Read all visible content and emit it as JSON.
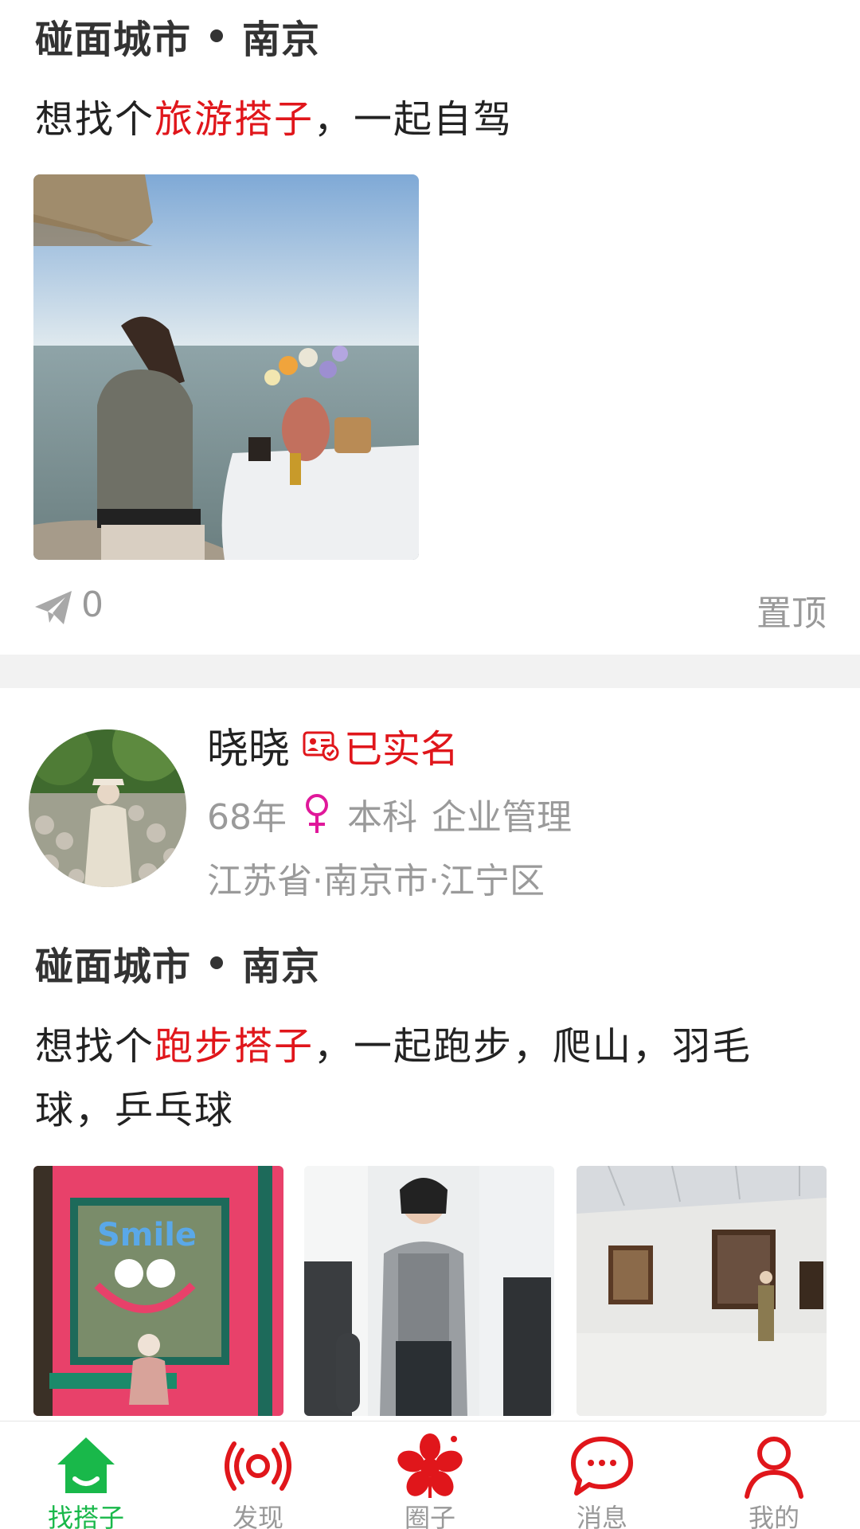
{
  "post1": {
    "meet_prefix": "碰面城市",
    "meet_city": "南京",
    "want_prefix": "想找个",
    "want_highlight": "旅游搭子",
    "want_suffix": "，一起自驾",
    "share_count": "0",
    "pin_label": "置顶"
  },
  "post2": {
    "user": {
      "name": "晓晓",
      "verified_label": "已实名",
      "birth_year": "68年",
      "education": "本科",
      "occupation": "企业管理",
      "location": "江苏省·南京市·江宁区"
    },
    "meet_prefix": "碰面城市",
    "meet_city": "南京",
    "want_prefix": "想找个",
    "want_highlight": "跑步搭子",
    "want_suffix_line1": "，一起跑步，爬山，羽毛",
    "want_suffix_line2": "球，乒乓球",
    "photo_texts": [
      "Smile"
    ]
  },
  "bottom_nav": [
    {
      "label": "找搭子",
      "icon": "home-icon",
      "active": true
    },
    {
      "label": "发现",
      "icon": "broadcast-icon",
      "active": false
    },
    {
      "label": "圈子",
      "icon": "flower-icon",
      "active": false
    },
    {
      "label": "消息",
      "icon": "chat-bubble-icon",
      "active": false
    },
    {
      "label": "我的",
      "icon": "person-icon",
      "active": false
    }
  ],
  "colors": {
    "highlight": "#e0161b",
    "active_nav": "#19b84a",
    "gray_text": "#9a9a9a",
    "divider": "#f2f2f2",
    "female": "#e0189a"
  }
}
